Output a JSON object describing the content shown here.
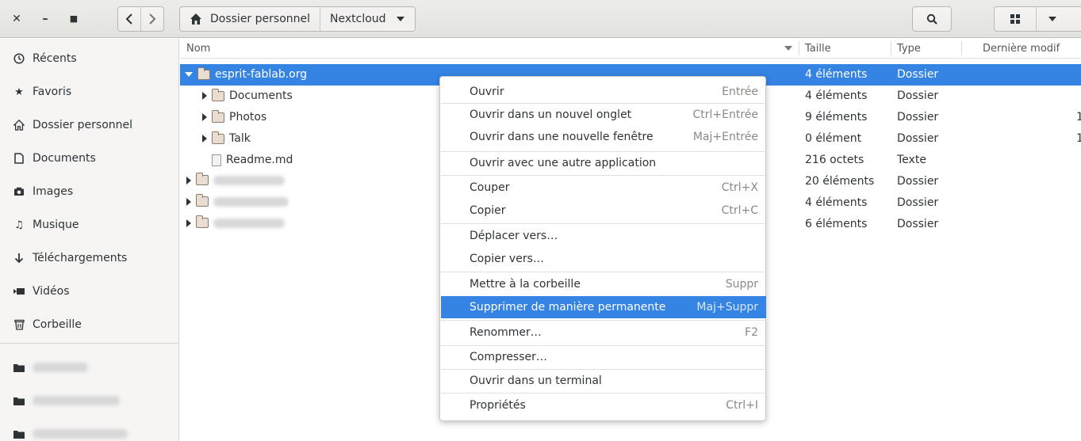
{
  "header": {
    "path": [
      {
        "label": "Dossier personnel"
      },
      {
        "label": "Nextcloud"
      }
    ]
  },
  "sidebar": {
    "items": [
      {
        "icon": "clock-icon",
        "label": "Récents"
      },
      {
        "icon": "star-icon",
        "label": "Favoris"
      },
      {
        "icon": "home-icon",
        "label": "Dossier personnel"
      },
      {
        "icon": "document-icon",
        "label": "Documents"
      },
      {
        "icon": "camera-icon",
        "label": "Images"
      },
      {
        "icon": "music-icon",
        "label": "Musique"
      },
      {
        "icon": "download-icon",
        "label": "Téléchargements"
      },
      {
        "icon": "video-icon",
        "label": "Vidéos"
      },
      {
        "icon": "trash-icon",
        "label": "Corbeille"
      }
    ]
  },
  "list": {
    "columns": {
      "name": "Nom",
      "size": "Taille",
      "type": "Type",
      "modified": "Dernière modif"
    },
    "rows": [
      {
        "name": "esprit-fablab.org",
        "size": "4 éléments",
        "type": "Dossier"
      },
      {
        "name": "Documents",
        "size": "4 éléments",
        "type": "Dossier"
      },
      {
        "name": "Photos",
        "size": "9 éléments",
        "type": "Dossier",
        "extra": "1"
      },
      {
        "name": "Talk",
        "size": "0 élément",
        "type": "Dossier",
        "extra": "1"
      },
      {
        "name": "Readme.md",
        "size": "216 octets",
        "type": "Texte"
      },
      {
        "name": "",
        "size": "20 éléments",
        "type": "Dossier"
      },
      {
        "name": "",
        "size": "4 éléments",
        "type": "Dossier"
      },
      {
        "name": "",
        "size": "6 éléments",
        "type": "Dossier"
      }
    ]
  },
  "context_menu": {
    "items": [
      {
        "label": "Ouvrir",
        "shortcut": "Entrée"
      },
      {
        "label": "Ouvrir dans un nouvel onglet",
        "shortcut": "Ctrl+Entrée"
      },
      {
        "label": "Ouvrir dans une nouvelle fenêtre",
        "shortcut": "Maj+Entrée"
      },
      {
        "label": "Ouvrir avec une autre application",
        "shortcut": ""
      },
      {
        "label": "Couper",
        "shortcut": "Ctrl+X"
      },
      {
        "label": "Copier",
        "shortcut": "Ctrl+C"
      },
      {
        "label": "Déplacer vers…",
        "shortcut": ""
      },
      {
        "label": "Copier vers…",
        "shortcut": ""
      },
      {
        "label": "Mettre à la corbeille",
        "shortcut": "Suppr"
      },
      {
        "label": "Supprimer de manière permanente",
        "shortcut": "Maj+Suppr"
      },
      {
        "label": "Renommer…",
        "shortcut": "F2"
      },
      {
        "label": "Compresser…",
        "shortcut": ""
      },
      {
        "label": "Ouvrir dans un terminal",
        "shortcut": ""
      },
      {
        "label": "Propriétés",
        "shortcut": "Ctrl+I"
      }
    ]
  },
  "colors": {
    "accent": "#3584e4",
    "sidebar_bg": "#f6f5f4",
    "header_bg": "#e6e5e2"
  }
}
